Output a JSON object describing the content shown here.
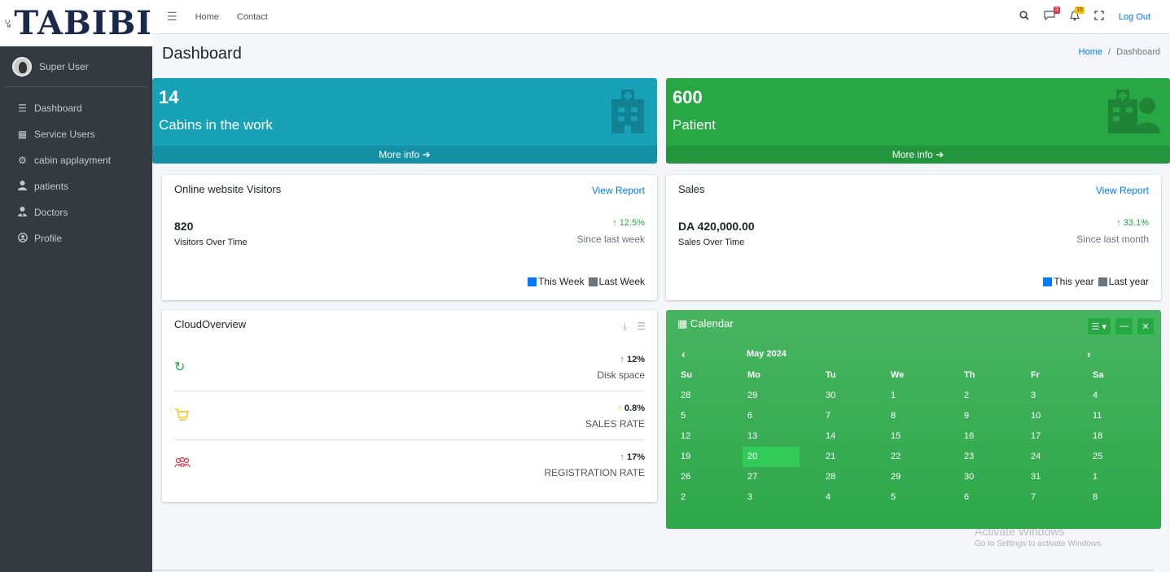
{
  "brand": {
    "name": "TABIBI"
  },
  "user": {
    "name": "Super User"
  },
  "sidebar": {
    "items": [
      {
        "label": "Dashboard",
        "icon": "menu-icon"
      },
      {
        "label": "Service Users",
        "icon": "grid-icon"
      },
      {
        "label": "cabin applayment",
        "icon": "cogs-icon"
      },
      {
        "label": "patients",
        "icon": "user-icon"
      },
      {
        "label": "Doctors",
        "icon": "user-doctor-icon"
      },
      {
        "label": "Profile",
        "icon": "profile-circle-icon"
      }
    ]
  },
  "topbar": {
    "home": "Home",
    "contact": "Contact",
    "messages_badge": "3",
    "notifications_badge": "15",
    "logout": "Log Out"
  },
  "header": {
    "title": "Dashboard",
    "breadcrumb_home": "Home",
    "breadcrumb_sep": "/",
    "breadcrumb_current": "Dashboard"
  },
  "stats": {
    "cabins": {
      "value": "14",
      "label": "Cabins in the work",
      "more": "More info"
    },
    "patients": {
      "value": "600",
      "label": "Patient",
      "more": "More info"
    }
  },
  "visitors": {
    "title": "Online website Visitors",
    "view_report": "View Report",
    "value": "820",
    "sub": "Visitors Over Time",
    "pct": "12.5%",
    "since": "Since last week",
    "legend_a": "This Week",
    "legend_b": "Last Week"
  },
  "sales": {
    "title": "Sales",
    "view_report": "View Report",
    "value": "DA 420,000.00",
    "sub": "Sales Over Time",
    "pct": "33.1%",
    "since": "Since last month",
    "legend_a": "This year",
    "legend_b": "Last year"
  },
  "cloud": {
    "title": "CloudOverview",
    "rows": [
      {
        "pct": "12%",
        "label": "Disk space",
        "color": "#28a745",
        "arrow_color": "#28a745"
      },
      {
        "pct": "0.8%",
        "label": "SALES RATE",
        "color": "#ffc107",
        "arrow_color": "#ffc107"
      },
      {
        "pct": "17%",
        "label": "REGISTRATION RATE",
        "color": "#dc3545",
        "arrow_color": "#28a745"
      }
    ]
  },
  "calendar": {
    "title": "Calendar",
    "month": "May 2024",
    "prev": "‹",
    "next": "›",
    "days": [
      "Su",
      "Mo",
      "Tu",
      "We",
      "Th",
      "Fr",
      "Sa"
    ],
    "weeks": [
      [
        "28",
        "29",
        "30",
        "1",
        "2",
        "3",
        "4"
      ],
      [
        "5",
        "6",
        "7",
        "8",
        "9",
        "10",
        "11"
      ],
      [
        "12",
        "13",
        "14",
        "15",
        "16",
        "17",
        "18"
      ],
      [
        "19",
        "20",
        "21",
        "22",
        "23",
        "24",
        "25"
      ],
      [
        "26",
        "27",
        "28",
        "29",
        "30",
        "31",
        "1"
      ],
      [
        "2",
        "3",
        "4",
        "5",
        "6",
        "7",
        "8"
      ]
    ],
    "today": "20"
  },
  "watermark": {
    "line1": "Activate Windows",
    "line2": "Go to Settings to activate Windows."
  },
  "colors": {
    "info": "#17a2b8",
    "success": "#28a745",
    "sidebar": "#343a40",
    "link": "#007bff"
  }
}
